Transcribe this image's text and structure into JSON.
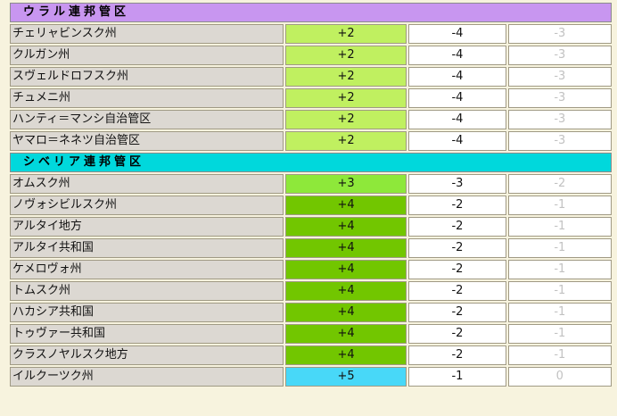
{
  "colors": {
    "background": "#f7f3de",
    "region_cell": "#dcd8d2",
    "offset_plus2": "#c0f060",
    "offset_plus3": "#8ee83a",
    "offset_plus4": "#72c600",
    "offset_plus5": "#48d8f8"
  },
  "sections": [
    {
      "title": "ウラル連邦管区",
      "header_color": "#c896f0",
      "rows": [
        {
          "region": "チェリャビンスク州",
          "offset": "+2",
          "offset_color": "#c0f060",
          "diff_a": "-4",
          "diff_b": "-3"
        },
        {
          "region": "クルガン州",
          "offset": "+2",
          "offset_color": "#c0f060",
          "diff_a": "-4",
          "diff_b": "-3"
        },
        {
          "region": "スヴェルドロフスク州",
          "offset": "+2",
          "offset_color": "#c0f060",
          "diff_a": "-4",
          "diff_b": "-3"
        },
        {
          "region": "チュメニ州",
          "offset": "+2",
          "offset_color": "#c0f060",
          "diff_a": "-4",
          "diff_b": "-3"
        },
        {
          "region": "ハンティ＝マンシ自治管区",
          "offset": "+2",
          "offset_color": "#c0f060",
          "diff_a": "-4",
          "diff_b": "-3"
        },
        {
          "region": "ヤマロ＝ネネツ自治管区",
          "offset": "+2",
          "offset_color": "#c0f060",
          "diff_a": "-4",
          "diff_b": "-3"
        }
      ]
    },
    {
      "title": "シベリア連邦管区",
      "header_color": "#00d8dc",
      "rows": [
        {
          "region": "オムスク州",
          "offset": "+3",
          "offset_color": "#8ee83a",
          "diff_a": "-3",
          "diff_b": "-2"
        },
        {
          "region": "ノヴォシビルスク州",
          "offset": "+4",
          "offset_color": "#72c600",
          "diff_a": "-2",
          "diff_b": "-1"
        },
        {
          "region": "アルタイ地方",
          "offset": "+4",
          "offset_color": "#72c600",
          "diff_a": "-2",
          "diff_b": "-1"
        },
        {
          "region": "アルタイ共和国",
          "offset": "+4",
          "offset_color": "#72c600",
          "diff_a": "-2",
          "diff_b": "-1"
        },
        {
          "region": "ケメロヴォ州",
          "offset": "+4",
          "offset_color": "#72c600",
          "diff_a": "-2",
          "diff_b": "-1"
        },
        {
          "region": "トムスク州",
          "offset": "+4",
          "offset_color": "#72c600",
          "diff_a": "-2",
          "diff_b": "-1"
        },
        {
          "region": "ハカシア共和国",
          "offset": "+4",
          "offset_color": "#72c600",
          "diff_a": "-2",
          "diff_b": "-1"
        },
        {
          "region": "トゥヴァー共和国",
          "offset": "+4",
          "offset_color": "#72c600",
          "diff_a": "-2",
          "diff_b": "-1"
        },
        {
          "region": "クラスノヤルスク地方",
          "offset": "+4",
          "offset_color": "#72c600",
          "diff_a": "-2",
          "diff_b": "-1"
        },
        {
          "region": "イルクーツク州",
          "offset": "+5",
          "offset_color": "#48d8f8",
          "diff_a": "-1",
          "diff_b": "0"
        }
      ]
    }
  ]
}
